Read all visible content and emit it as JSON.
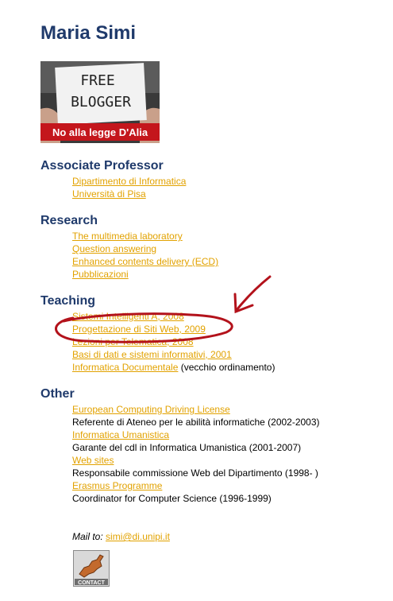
{
  "name": "Maria Simi",
  "banner": {
    "line1": "FREE",
    "line2": "BLOGGER",
    "caption": "No alla legge D'Alia"
  },
  "sections": [
    {
      "heading": "Associate Professor",
      "items": [
        {
          "link": "Dipartimento di Informatica",
          "text": ""
        },
        {
          "link": "Università di Pisa",
          "text": ""
        }
      ]
    },
    {
      "heading": "Research",
      "items": [
        {
          "link": "The multimedia laboratory",
          "text": ""
        },
        {
          "link": "Question answering",
          "text": ""
        },
        {
          "link": "Enhanced contents delivery (ECD)",
          "text": ""
        },
        {
          "link": "Pubblicazioni",
          "text": ""
        }
      ]
    },
    {
      "heading": "Teaching",
      "items": [
        {
          "link": "Sistemi Intelligenti A, 2008",
          "text": ""
        },
        {
          "link": "Progettazione di Siti Web, 2009",
          "text": ""
        },
        {
          "link": "Lezioni per Telematica, 2008",
          "text": ""
        },
        {
          "link": "Basi di dati e sistemi informativi, 2001",
          "text": ""
        },
        {
          "link": "Informatica Documentale",
          "text": " (vecchio ordinamento)"
        }
      ]
    },
    {
      "heading": "Other",
      "items": [
        {
          "link": "European Computing Driving License",
          "text": ""
        },
        {
          "link": "",
          "text": "Referente di Ateneo per le abilità informatiche (2002-2003)"
        },
        {
          "link": "Informatica Umanistica",
          "text": ""
        },
        {
          "link": "",
          "text": "Garante del cdl in Informatica Umanistica (2001-2007)"
        },
        {
          "link": "Web sites",
          "text": ""
        },
        {
          "link": "",
          "text": "Responsabile commissione Web del Dipartimento (1998- )"
        },
        {
          "link": "Erasmus Programme",
          "text": ""
        },
        {
          "link": "",
          "text": "Coordinator for Computer Science (1996-1999)"
        }
      ]
    }
  ],
  "mail": {
    "label": "Mail to:",
    "address": "simi@di.unipi.it"
  },
  "contact_label": "CONTACT",
  "colors": {
    "heading": "#1f3a6b",
    "link": "#e2a200",
    "annotation": "#b3121b"
  }
}
